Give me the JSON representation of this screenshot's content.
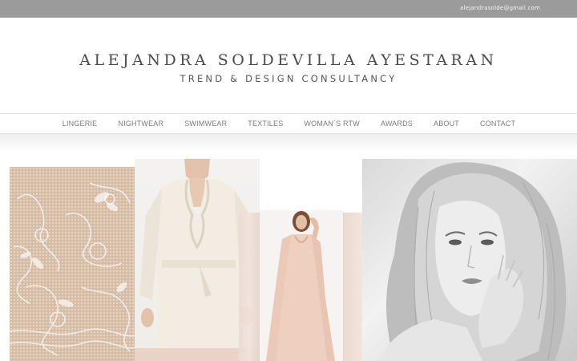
{
  "header": {
    "email": "alejandrasolde@gmail.com",
    "brand_name": "ALEJANDRA SOLDEVILLA AYESTARAN",
    "tagline": "TREND & DESIGN CONSULTANCY"
  },
  "nav": {
    "items": [
      {
        "label": "LINGERIE"
      },
      {
        "label": "NIGHTWEAR"
      },
      {
        "label": "SWIMWEAR"
      },
      {
        "label": "TEXTILES"
      },
      {
        "label": "WOMAN´S RTW"
      },
      {
        "label": "AWARDS"
      },
      {
        "label": "ABOUT"
      },
      {
        "label": "CONTACT"
      }
    ]
  },
  "colors": {
    "topbar": "#9b9b9b",
    "text": "#4a4a4a",
    "lace_bg": "#d6bba5",
    "blush": "#f1e4dd"
  },
  "gallery": {
    "images": [
      {
        "icon": "lace-swatch-image"
      },
      {
        "icon": "satin-robe-photo"
      },
      {
        "icon": "blush-gown-photo"
      },
      {
        "icon": "blonde-portrait-photo"
      }
    ]
  }
}
